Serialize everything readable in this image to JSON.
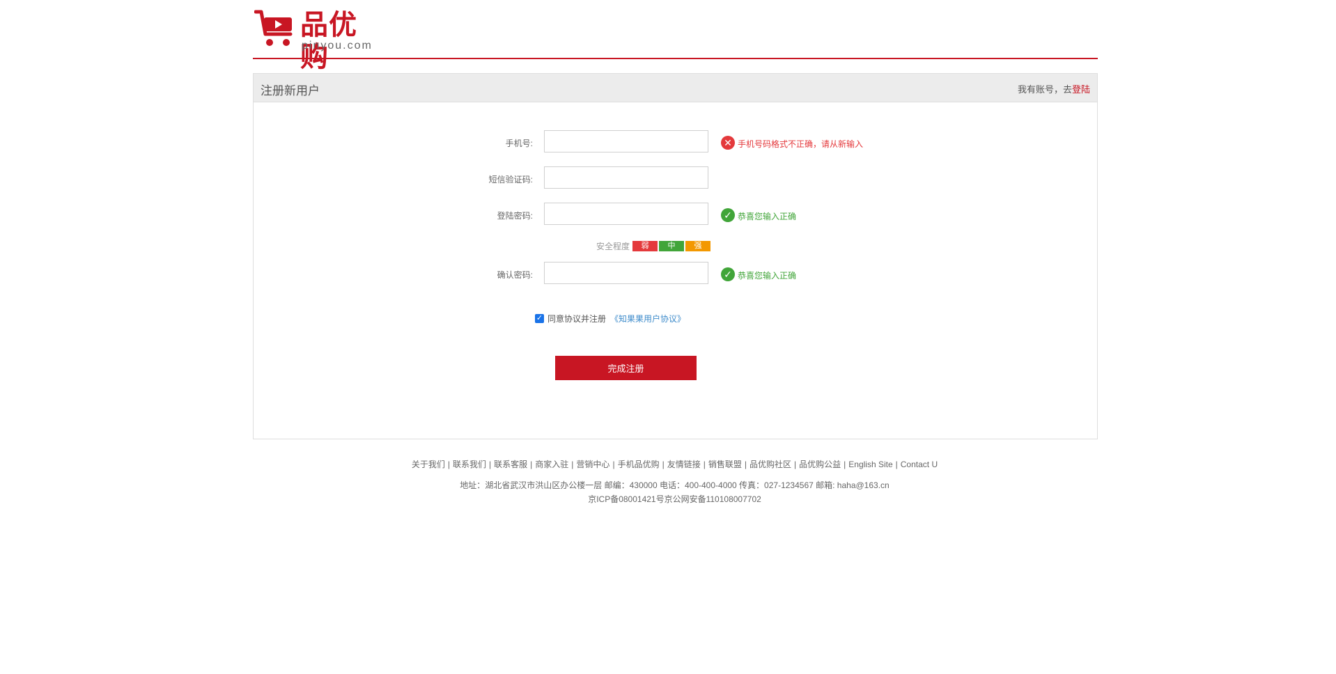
{
  "brand": {
    "name": "品优购",
    "domain": "pinyou.com",
    "color": "#c81623"
  },
  "panel": {
    "title": "注册新用户",
    "login_prefix": "我有账号，去",
    "login_link": "登陆"
  },
  "form": {
    "phone": {
      "label": "手机号:",
      "value": "",
      "message": "手机号码格式不正确，请从新输入",
      "status": "error"
    },
    "sms": {
      "label": "短信验证码:",
      "value": ""
    },
    "password": {
      "label": "登陆密码:",
      "value": "",
      "message": "恭喜您输入正确",
      "status": "ok"
    },
    "strength": {
      "label": "安全程度",
      "weak": "弱",
      "medium": "中",
      "strong": "强",
      "colors": [
        "#e4393c",
        "#41a539",
        "#f39800"
      ]
    },
    "confirm": {
      "label": "确认密码:",
      "value": "",
      "message": "恭喜您输入正确",
      "status": "ok"
    },
    "agree": {
      "text": "同意协议并注册",
      "link": "《知果果用户协议》",
      "checked": true
    },
    "submit": "完成注册"
  },
  "footer": {
    "links": [
      "关于我们",
      "联系我们",
      "联系客服",
      "商家入驻",
      "营销中心",
      "手机品优购",
      "友情链接",
      "销售联盟",
      "品优购社区",
      "品优购公益",
      "English Site",
      "Contact U"
    ],
    "address": "地址：湖北省武汉市洪山区办公楼一层 邮编：430000 电话：400-400-4000 传真：027-1234567 邮箱: haha@163.cn",
    "icp": "京ICP备08001421号京公网安备110108007702"
  }
}
